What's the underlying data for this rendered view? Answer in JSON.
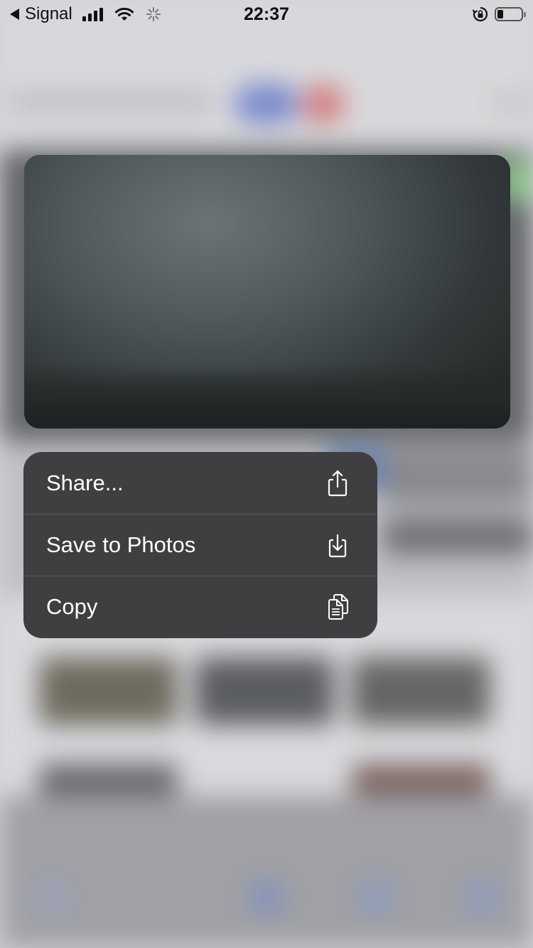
{
  "status_bar": {
    "back_app": "Signal",
    "time": "22:37",
    "signal_bars": 4,
    "battery_level_fraction": 0.25
  },
  "preview": {
    "description_icon": "photo-preview"
  },
  "context_menu": {
    "items": [
      {
        "label": "Share...",
        "icon": "share-icon"
      },
      {
        "label": "Save to Photos",
        "icon": "save-to-photos-icon"
      },
      {
        "label": "Copy",
        "icon": "copy-icon"
      }
    ]
  },
  "colors": {
    "menu_background": "#3f3f42",
    "menu_text": "#ffffff",
    "menu_separator": "#5a5a5e"
  }
}
